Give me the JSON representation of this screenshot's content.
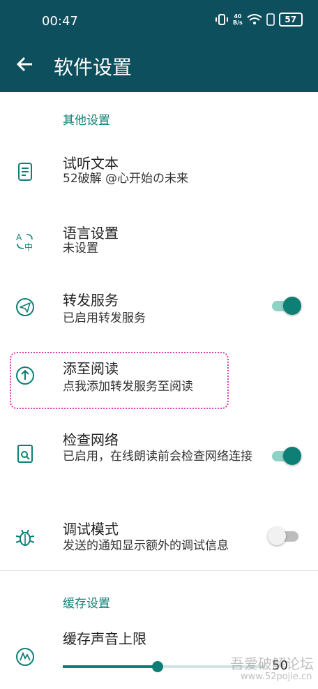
{
  "status_bar": {
    "time": "00:47",
    "net_speed_top": "40",
    "net_speed_bottom": "B/s",
    "battery": "57"
  },
  "app_bar": {
    "title": "软件设置"
  },
  "sections": [
    {
      "header": "其他设置",
      "items": [
        {
          "title": "试听文本",
          "subtitle": "52破解 @心开始の未来",
          "icon": "text-sample-icon"
        },
        {
          "title": "语言设置",
          "subtitle": "未设置",
          "icon": "translate-icon"
        },
        {
          "title": "转发服务",
          "subtitle": "已启用转发服务",
          "icon": "send-icon",
          "switch_on": true
        },
        {
          "title": "添至阅读",
          "subtitle": "点我添加转发服务至阅读",
          "icon": "upload-icon"
        },
        {
          "title": "检查网络",
          "subtitle": "已启用，在线朗读前会检查网络连接",
          "icon": "network-check-icon",
          "switch_on": true
        },
        {
          "title": "调试模式",
          "subtitle": "发送的通知显示额外的调试信息",
          "icon": "bug-icon",
          "switch_on": false
        }
      ]
    },
    {
      "header": "缓存设置",
      "items": [
        {
          "title": "缓存声音上限",
          "icon": "audio-cache-icon",
          "slider_value_fraction": 0.47,
          "slider_value_label": "50"
        }
      ]
    }
  ],
  "watermark": {
    "text": "吾爱破解论坛",
    "url": "www.52pojie.cn"
  },
  "colors": {
    "app_bar": "#0d4f5c",
    "accent": "#0d7f74",
    "focus_outline": "#d63fb0"
  }
}
